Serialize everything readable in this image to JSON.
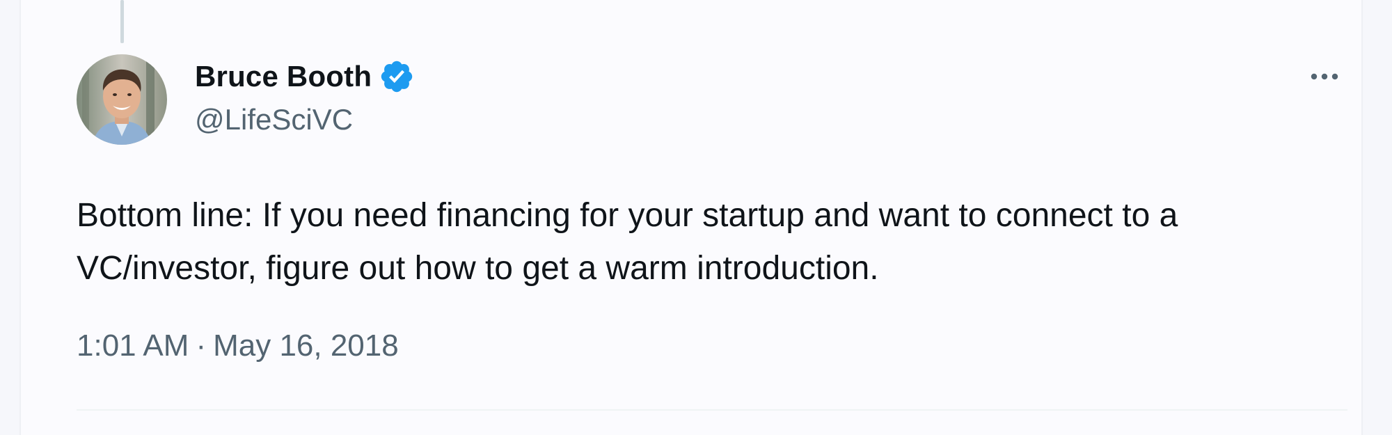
{
  "tweet": {
    "author": {
      "display_name": "Bruce Booth",
      "handle": "@LifeSciVC",
      "verified": true,
      "avatar_icon": "profile-photo"
    },
    "text": "Bottom line: If you need financing for your startup and want to connect to a VC/investor, figure out how to get a warm introduction.",
    "time": "1:01 AM",
    "separator": "·",
    "date": "May 16, 2018",
    "more_icon": "more-horizontal-icon"
  },
  "colors": {
    "verified_blue": "#1d9bf0",
    "text_primary": "#0f1419",
    "text_secondary": "#536471",
    "thread_line": "#cfd9de",
    "divider": "#eff3f4"
  }
}
